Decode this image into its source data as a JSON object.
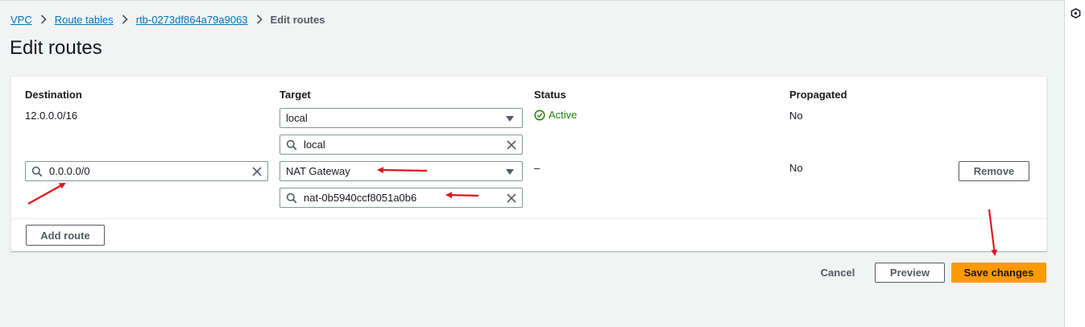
{
  "breadcrumb": {
    "items": [
      "VPC",
      "Route tables",
      "rtb-0273df864a79a9063"
    ],
    "current": "Edit routes"
  },
  "page": {
    "title": "Edit routes"
  },
  "table": {
    "headers": {
      "destination": "Destination",
      "target": "Target",
      "status": "Status",
      "propagated": "Propagated"
    },
    "rows": [
      {
        "destination": "12.0.0.0/16",
        "target_select": "local",
        "target_search": "local",
        "status": "Active",
        "propagated": "No"
      },
      {
        "destination_search": "0.0.0.0/0",
        "target_select": "NAT Gateway",
        "target_search": "nat-0b5940ccf8051a0b6",
        "status": "–",
        "propagated": "No",
        "remove_label": "Remove"
      }
    ],
    "add_route_label": "Add route"
  },
  "footer": {
    "cancel_label": "Cancel",
    "preview_label": "Preview",
    "save_label": "Save changes"
  },
  "colors": {
    "accent": "#ff9900",
    "link": "#0073bb",
    "success": "#1d8102",
    "annotation_arrow": "#e0161e"
  }
}
